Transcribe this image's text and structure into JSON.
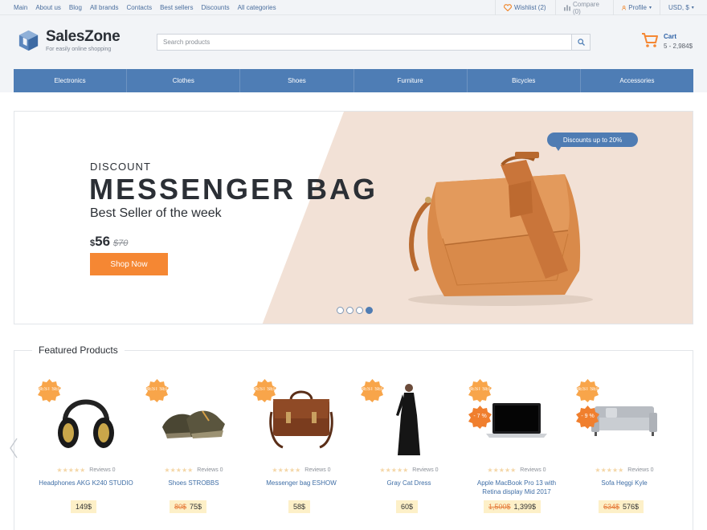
{
  "topbar": {
    "links": [
      "Main",
      "About us",
      "Blog",
      "All brands",
      "Contacts",
      "Best sellers",
      "Discounts",
      "All categories"
    ],
    "wishlist": "Wishlist (2)",
    "compare": "Compare (0)",
    "profile": "Profile",
    "currency": "USD, $"
  },
  "header": {
    "logo_name": "SalesZone",
    "logo_tagline": "For easily online shopping",
    "search_placeholder": "Search products",
    "cart_label": "Cart",
    "cart_summary": "5 - 2,984$"
  },
  "nav": [
    "Electronics",
    "Clothes",
    "Shoes",
    "Furniture",
    "Bicycles",
    "Accessories"
  ],
  "banner": {
    "kicker": "DISCOUNT",
    "title": "MESSENGER BAG",
    "subtitle": "Best Seller of the week",
    "price_currency": "$",
    "price_now": "56",
    "price_old": "$70",
    "cta": "Shop Now",
    "tooltip": "Discounts up to 20%",
    "slides": 4,
    "active_slide": 4
  },
  "featured": {
    "title": "Featured Products",
    "products": [
      {
        "name": "Headphones AKG K240 STUDIO",
        "reviews": "Reviews 0",
        "price": "149$",
        "old_price": "",
        "badge": "BEST SELLER",
        "discount": ""
      },
      {
        "name": "Shoes STROBBS",
        "reviews": "Reviews 0",
        "price": "75$",
        "old_price": "80$",
        "badge": "BEST SELLER",
        "discount": ""
      },
      {
        "name": "Messenger bag ESHOW",
        "reviews": "Reviews 0",
        "price": "58$",
        "old_price": "",
        "badge": "BEST SELLER",
        "discount": ""
      },
      {
        "name": "Gray Cat Dress",
        "reviews": "Reviews 0",
        "price": "60$",
        "old_price": "",
        "badge": "BEST SELLER",
        "discount": ""
      },
      {
        "name": "Apple MacBook Pro 13 with Retina display Mid 2017",
        "reviews": "Reviews 0",
        "price": "1,399$",
        "old_price": "1,500$",
        "badge": "BEST SELLER",
        "discount": "- 7 %"
      },
      {
        "name": "Sofa Heggi Kyle",
        "reviews": "Reviews 0",
        "price": "576$",
        "old_price": "634$",
        "badge": "BEST SELLER",
        "discount": "- 9 %"
      }
    ]
  },
  "colors": {
    "accent": "#4e7db5",
    "orange": "#f58733",
    "link": "#3f6ea6"
  }
}
